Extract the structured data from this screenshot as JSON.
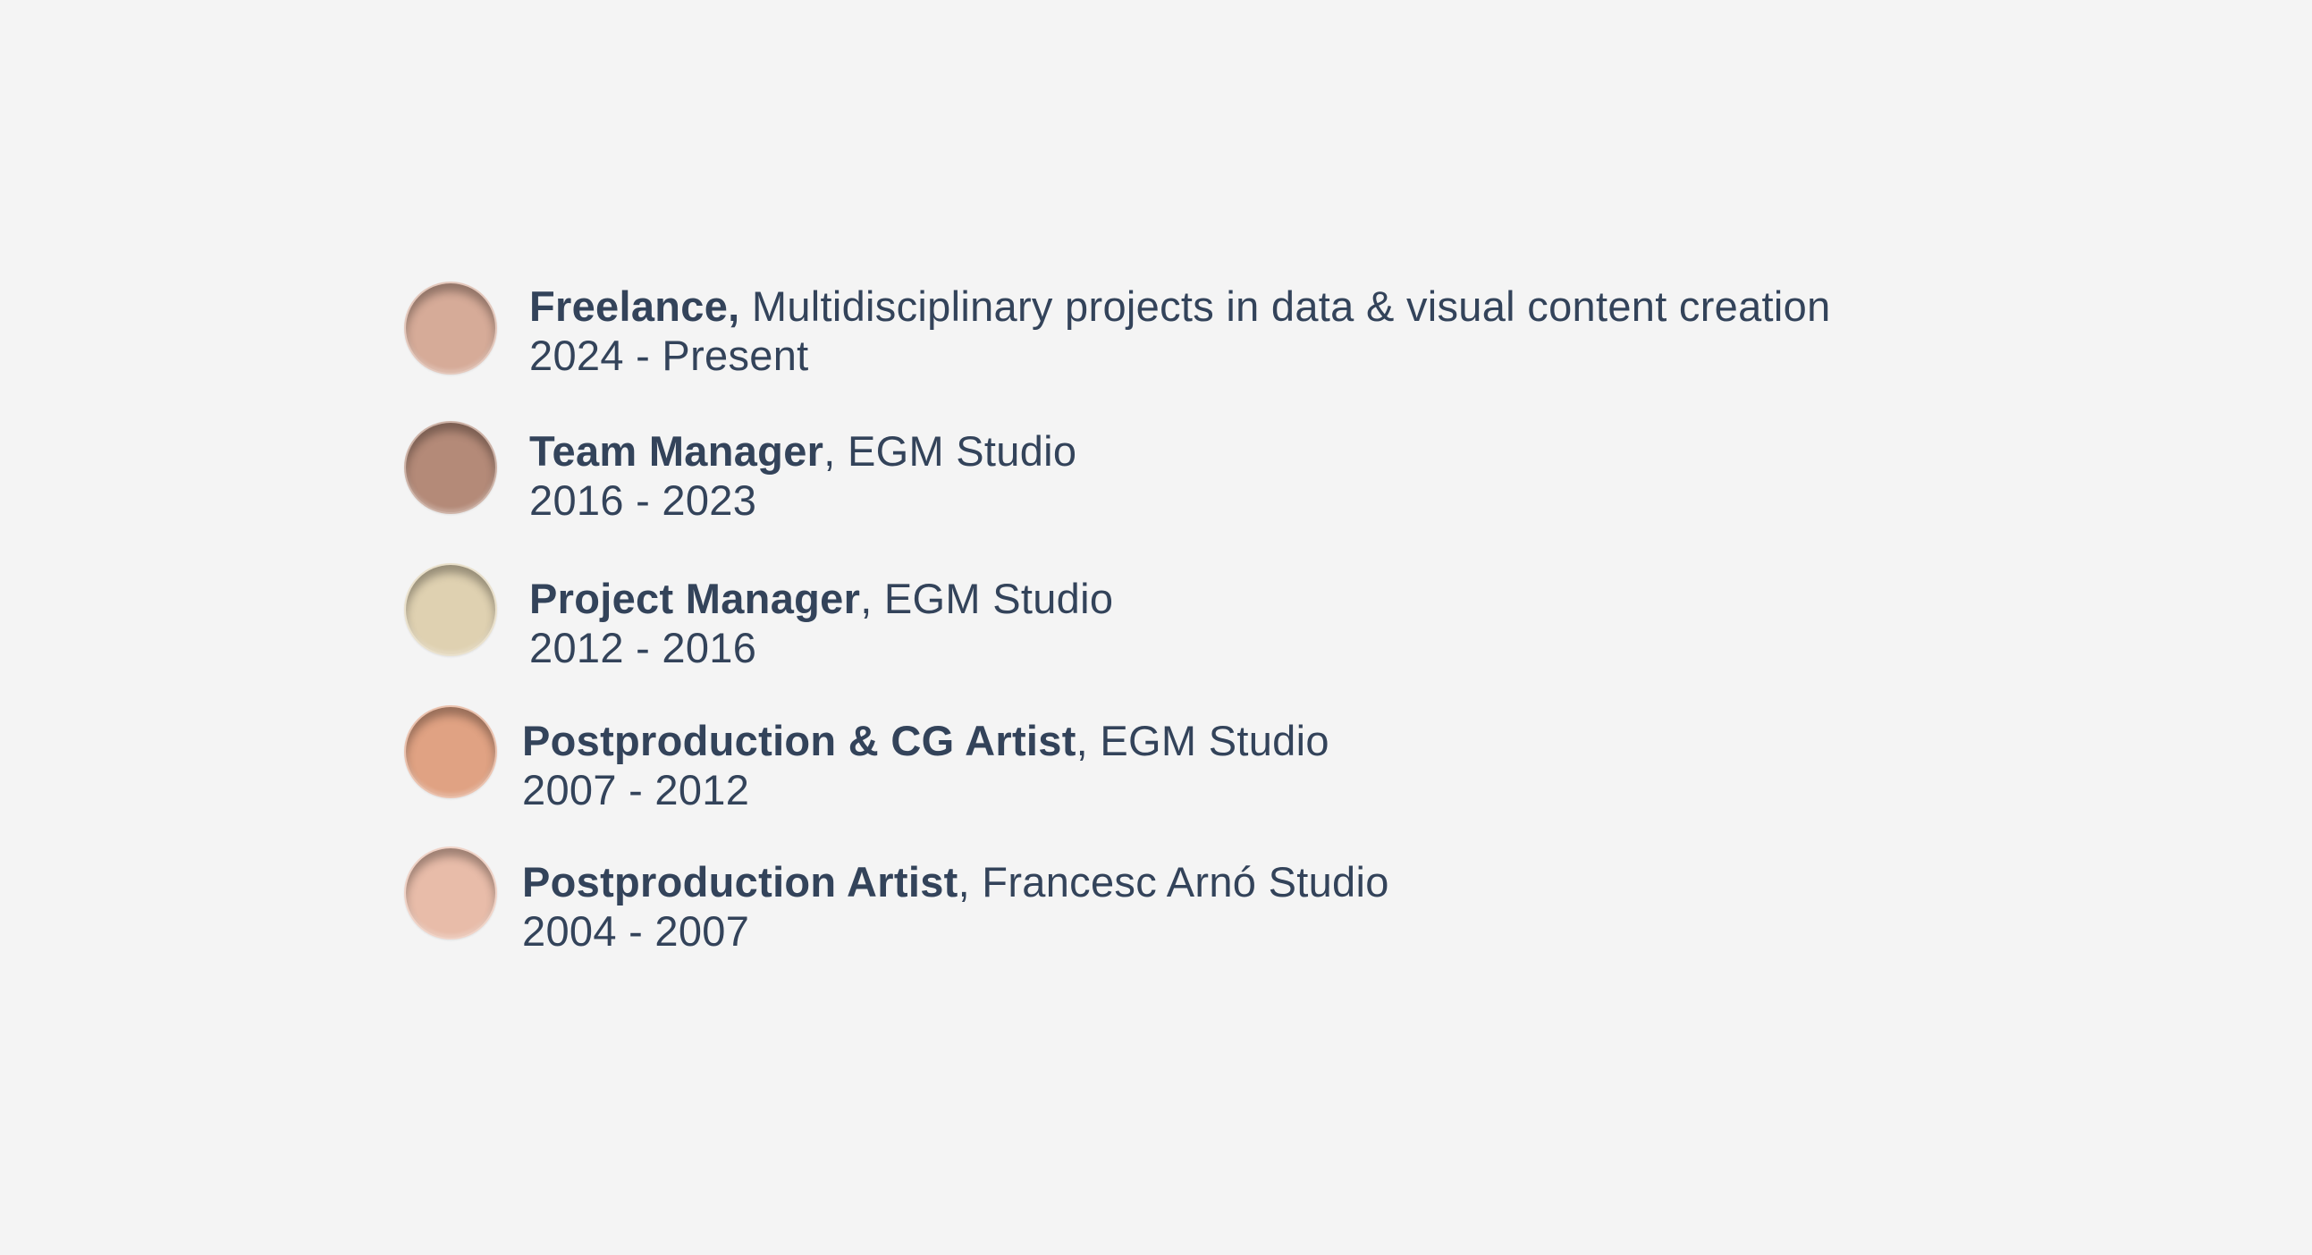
{
  "entries": [
    {
      "role": "Freelance,",
      "rest": " Multidisciplinary projects in data & visual content creation",
      "period": "2024 - Present",
      "dot_color": "#d6ab98"
    },
    {
      "role": "Team Manager",
      "rest": ", EGM Studio",
      "period": "2016 - 2023",
      "dot_color": "#b48a78"
    },
    {
      "role": "Project Manager",
      "rest": ", EGM Studio",
      "period": "2012 - 2016",
      "dot_color": "#dfd1b1"
    },
    {
      "role": "Postproduction & CG Artist",
      "rest": ", EGM Studio",
      "period": "2007 - 2012",
      "dot_color": "#e0a283"
    },
    {
      "role": "Postproduction Artist",
      "rest": ", Francesc Arnó Studio",
      "period": "2004 - 2007",
      "dot_color": "#e8bca9"
    }
  ]
}
